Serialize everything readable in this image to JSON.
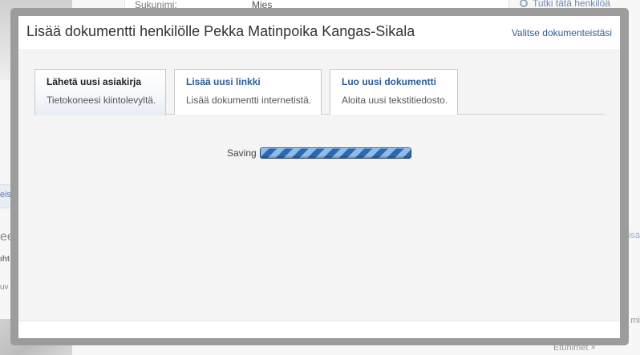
{
  "background": {
    "card_label": "Sukunimi:",
    "card_value": "Mies",
    "research_link": "Tutki tätä henkilöä",
    "left_fragment_1": "eis",
    "left_fragment_2": "ee",
    "left_fragment_3": "ıht",
    "left_fragment_4": "uv",
    "right_fragment_1": "isä",
    "right_fragment_2": "mi",
    "right_fragment_3": "Etunimet ×"
  },
  "modal": {
    "title": "Lisää dokumentti henkilölle Pekka Matinpoika Kangas-Sikala",
    "header_link": "Valitse dokumenteistäsi",
    "tabs": [
      {
        "title": "Lähetä uusi asiakirja",
        "description": "Tietokoneesi kiintolevyltä.",
        "active": true
      },
      {
        "title": "Lisää uusi linkki",
        "description": "Lisää dokumentti internetistä.",
        "active": false
      },
      {
        "title": "Luo uusi dokumentti",
        "description": "Aloita uusi tekstitiedosto.",
        "active": false
      }
    ],
    "saving_label": "Saving",
    "progress_fraction": 1.0
  }
}
